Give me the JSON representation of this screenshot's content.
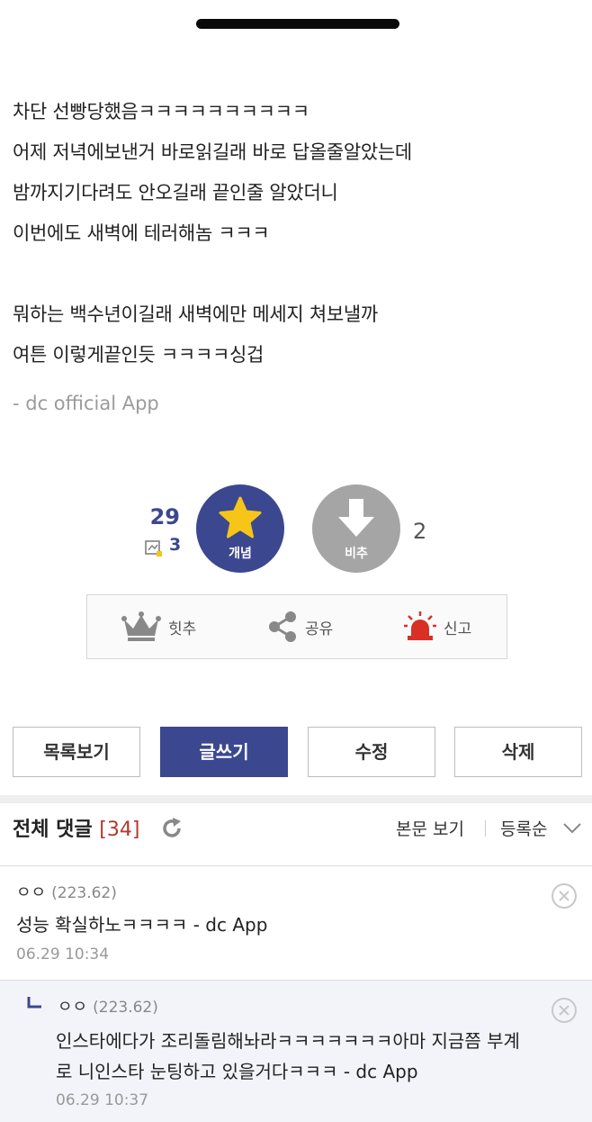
{
  "post": {
    "lines": [
      "차단 선빵당했음ㅋㅋㅋㅋㅋㅋㅋㅋㅋㅋ",
      "어제 저녁에보낸거 바로읽길래 바로 답올줄알았는데",
      "밤까지기다려도 안오길래 끝인줄 알았더니",
      "이번에도 새벽에 테러해놈 ㅋㅋㅋ",
      "뭐하는 백수년이길래 새벽에만 메세지 쳐보낼까",
      "여튼 이렇게끝인듯 ㅋㅋㅋㅋ싱겁"
    ],
    "signature": "- dc official App"
  },
  "vote": {
    "up_count": "29",
    "fixed_count": "3",
    "up_label": "개념",
    "down_label": "비추",
    "down_count": "2"
  },
  "actions": {
    "hit": "힛추",
    "share": "공유",
    "report": "신고"
  },
  "buttons": {
    "list": "목록보기",
    "write": "글쓰기",
    "edit": "수정",
    "delete": "삭제"
  },
  "comments": {
    "title": "전체 댓글",
    "count": "[34]",
    "view_post": "본문 보기",
    "sort": "등록순",
    "items": [
      {
        "name": "ㅇㅇ",
        "ip": "(223.62)",
        "text": "성능 확실하노ㅋㅋㅋㅋ - dc App",
        "date": "06.29 10:34"
      },
      {
        "name": "ㅇㅇ",
        "ip": "(223.62)",
        "text_line1": "인스타에다가 조리돌림해놔라ㅋㅋㅋㅋㅋㅋㅋ아마 지금쯤 부계",
        "text_line2": "로 니인스타 눈팅하고 있을거다ㅋㅋㅋ - dc App",
        "date": "06.29 10:37"
      }
    ]
  },
  "colors": {
    "accent": "#3b4890",
    "count_red": "#b03a2e",
    "down_gray": "#a5a5a5",
    "star": "#f5c518",
    "report_red": "#d93025"
  },
  "icons": [
    "star-icon",
    "arrow-down-icon",
    "crown-icon",
    "share-icon",
    "siren-icon",
    "refresh-icon",
    "chevron-down-icon",
    "close-icon",
    "reply-arrow-icon",
    "fixed-comment-icon"
  ]
}
